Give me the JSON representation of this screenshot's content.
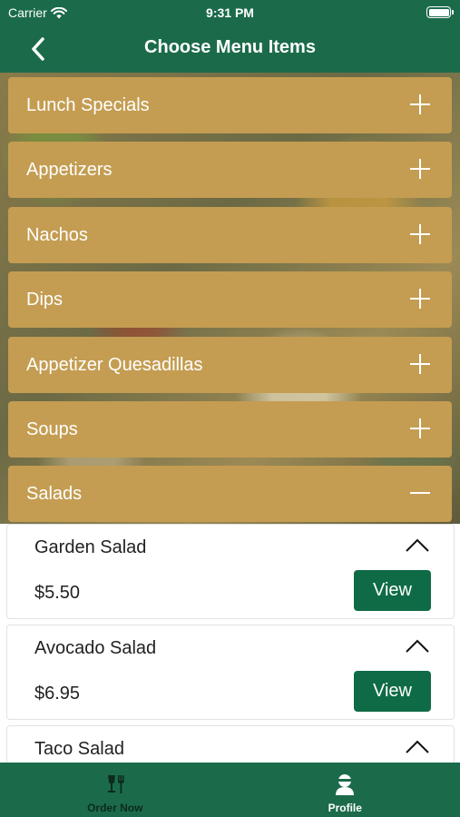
{
  "status_bar": {
    "carrier": "Carrier",
    "time": "9:31 PM"
  },
  "header": {
    "title": "Choose Menu Items"
  },
  "categories": [
    {
      "label": "Lunch Specials",
      "expanded": false
    },
    {
      "label": "Appetizers",
      "expanded": false
    },
    {
      "label": "Nachos",
      "expanded": false
    },
    {
      "label": "Dips",
      "expanded": false
    },
    {
      "label": "Appetizer Quesadillas",
      "expanded": false
    },
    {
      "label": "Soups",
      "expanded": false
    },
    {
      "label": "Salads",
      "expanded": true
    }
  ],
  "items": [
    {
      "name": "Garden Salad",
      "price": "$5.50",
      "button": "View"
    },
    {
      "name": "Avocado Salad",
      "price": "$6.95",
      "button": "View"
    },
    {
      "name": "Taco Salad"
    }
  ],
  "tab_bar": [
    {
      "label": "Order Now",
      "icon": "dining-icon",
      "active": false
    },
    {
      "label": "Profile",
      "icon": "profile-icon",
      "active": true
    }
  ],
  "colors": {
    "header": "#1b6b4b",
    "category": "#c49d52",
    "view_button": "#0f6b45"
  }
}
